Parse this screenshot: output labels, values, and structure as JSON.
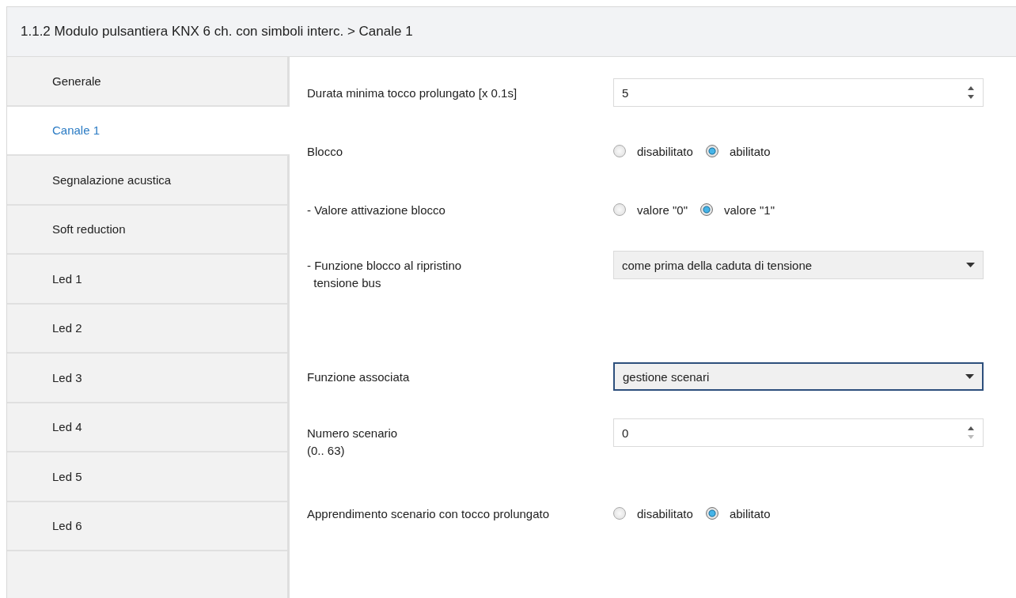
{
  "window": {
    "title": "1.1.2 Modulo pulsantiera KNX 6 ch. con simboli interc. > Canale 1"
  },
  "sidebar": {
    "items": [
      {
        "label": "Generale",
        "selected": false
      },
      {
        "label": "Canale 1",
        "selected": true
      },
      {
        "label": "Segnalazione acustica",
        "selected": false
      },
      {
        "label": "Soft reduction",
        "selected": false
      },
      {
        "label": "Led 1",
        "selected": false
      },
      {
        "label": "Led 2",
        "selected": false
      },
      {
        "label": "Led 3",
        "selected": false
      },
      {
        "label": "Led 4",
        "selected": false
      },
      {
        "label": "Led 5",
        "selected": false
      },
      {
        "label": "Led 6",
        "selected": false
      }
    ]
  },
  "parameters": [
    {
      "kind": "spinner",
      "label": "Durata minima tocco prolungato [x 0.1s]",
      "value": "5",
      "down_disabled": false
    },
    {
      "kind": "radio",
      "label": "Blocco",
      "options": [
        {
          "label": "disabilitato",
          "selected": false
        },
        {
          "label": "abilitato",
          "selected": true
        }
      ]
    },
    {
      "kind": "radio",
      "label": "- Valore attivazione blocco",
      "options": [
        {
          "label": "valore \"0\"",
          "selected": false
        },
        {
          "label": "valore \"1\"",
          "selected": true
        }
      ]
    },
    {
      "kind": "dropdown",
      "label": "- Funzione blocco al ripristino\n  tensione bus",
      "value": "come prima della caduta di tensione",
      "focused": false
    },
    {
      "kind": "dropdown",
      "label": "Funzione associata",
      "value": "gestione scenari",
      "focused": true
    },
    {
      "kind": "spinner",
      "label": "Numero scenario\n(0.. 63)",
      "value": "0",
      "down_disabled": true
    },
    {
      "kind": "radio",
      "label": "Apprendimento scenario con tocco prolungato",
      "options": [
        {
          "label": "disabilitato",
          "selected": false
        },
        {
          "label": "abilitato",
          "selected": true
        }
      ]
    }
  ]
}
